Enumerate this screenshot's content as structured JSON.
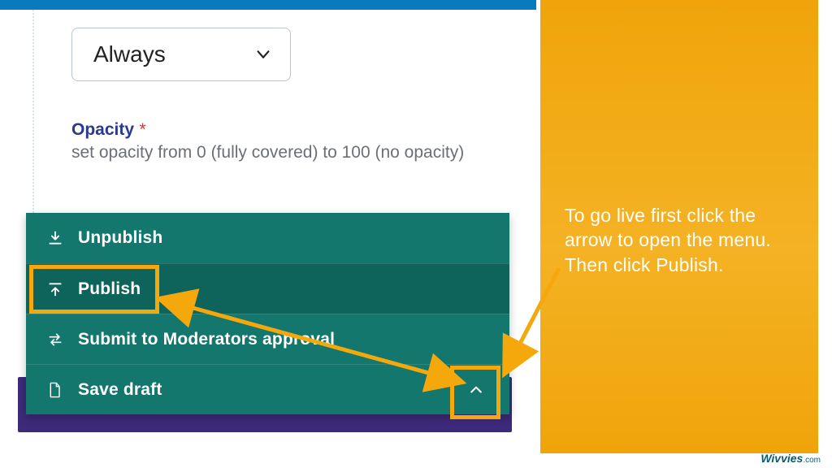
{
  "top_bar_color": "#0a7abf",
  "dropdown": {
    "label": "Always"
  },
  "opacity": {
    "label": "Opacity",
    "required_mark": "*",
    "help": "set opacity from 0 (fully covered) to 100 (no opacity)"
  },
  "menu": {
    "unpublish": "Unpublish",
    "publish": "Publish",
    "submit": "Submit to Moderators approval",
    "save_draft": "Save draft"
  },
  "instruction": "To go live first click the arrow to open the menu. Then click Publish.",
  "brand": {
    "name": "Wivvies",
    "suffix": ".com"
  }
}
